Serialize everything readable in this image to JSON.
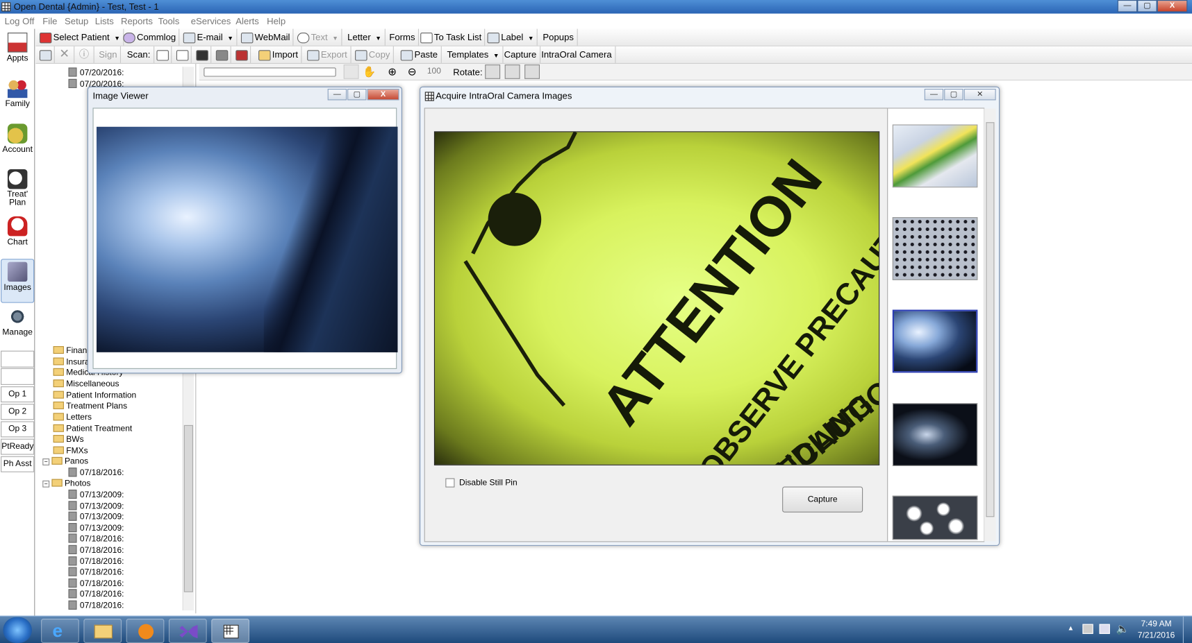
{
  "window": {
    "title": "Open Dental {Admin} - Test, Test - 1",
    "min": "—",
    "max": "▢",
    "close": "X"
  },
  "menu": [
    "Log Off",
    "File",
    "Setup",
    "Lists",
    "Reports",
    "Tools",
    "eServices",
    "Alerts",
    "Help"
  ],
  "toolbar1": {
    "select_patient": "Select Patient",
    "commlog": "Commlog",
    "email": "E-mail",
    "webmail": "WebMail",
    "text": "Text",
    "letter": "Letter",
    "forms": "Forms",
    "task": "To Task List",
    "label": "Label",
    "popups": "Popups"
  },
  "toolbar2": {
    "sign": "Sign",
    "scan": "Scan:",
    "import": "Import",
    "export": "Export",
    "copy": "Copy",
    "paste": "Paste",
    "templates": "Templates",
    "capture": "Capture",
    "intraoral": "IntraOral Camera"
  },
  "viewer_toolbar": {
    "zoom": "100",
    "rotate": "Rotate:"
  },
  "modules": [
    {
      "label": "Appts"
    },
    {
      "label": "Family"
    },
    {
      "label": "Account"
    },
    {
      "label": "Treat' Plan"
    },
    {
      "label": "Chart"
    },
    {
      "label": "Images"
    },
    {
      "label": "Manage"
    }
  ],
  "ops": [
    "Op 1",
    "Op 2",
    "Op 3",
    "PtReady",
    "Ph Asst"
  ],
  "tree": {
    "top_dates": [
      "07/20/2016:",
      "07/20/2016:"
    ],
    "folders": [
      "Financial",
      "Insurance",
      "Medical History",
      "Miscellaneous",
      "Patient Information",
      "Treatment Plans",
      "Letters",
      "Patient Treatment",
      "BWs",
      "FMXs",
      "Panos"
    ],
    "panos_dates": [
      "07/18/2016:"
    ],
    "photos_label": "Photos",
    "photos_dates": [
      "07/13/2009:",
      "07/13/2009:",
      "07/13/2009:",
      "07/13/2009:",
      "07/18/2016:",
      "07/18/2016:",
      "07/18/2016:",
      "07/18/2016:",
      "07/18/2016:",
      "07/18/2016:",
      "07/18/2016:"
    ]
  },
  "image_viewer": {
    "title": "Image Viewer"
  },
  "acquire": {
    "title": "Acquire IntraOral Camera Images",
    "disable_still_pin": "Disable Still Pin",
    "capture": "Capture",
    "image_text": [
      "ATTENTION",
      "OBSERVE PRECAUTIONS",
      "PRECAUTIONS",
      "HANDLING"
    ]
  },
  "taskbar": {
    "time": "7:49 AM",
    "date": "7/21/2016"
  }
}
